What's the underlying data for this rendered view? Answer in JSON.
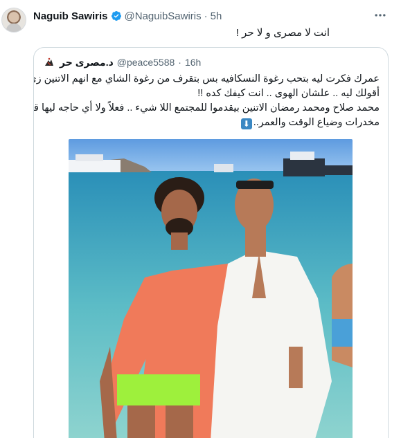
{
  "tweet": {
    "author_name": "Naguib Sawiris",
    "handle": "@NaguibSawiris",
    "separator": "·",
    "time": "5h",
    "text": "انت لا مصرى و لا حر !",
    "more_icon": "more-dots-icon",
    "verified_icon": "verified-badge-icon"
  },
  "quoted_tweet": {
    "author_name": "د.مصرى حر",
    "handle": "@peace5588",
    "separator": "·",
    "time": "16h",
    "lines": [
      "عمرك فكرت ليه بتحب رغوة النسكافيه بس بتقرف من رغوة الشاي مع انهم الاتنين زي بعض يعني ؟!",
      "أقولك ليه .. علشان الهوى .. انت كيفك كده !!",
      "محمد صلاح ومحمد رمضان الاتنين بيقدموا للمجتمع اللا شيء .. فعلاً ولا أي حاجه ليها قيمه .. شوية",
      "مخدرات وضياع الوقت والعمر.."
    ],
    "down_arrow_emoji": "⬇",
    "photo_icon": "photo-two-men-beach"
  },
  "colors": {
    "text": "#0f1419",
    "secondary": "#536471",
    "verified": "#1d9bf0",
    "border": "#cfd9de"
  }
}
